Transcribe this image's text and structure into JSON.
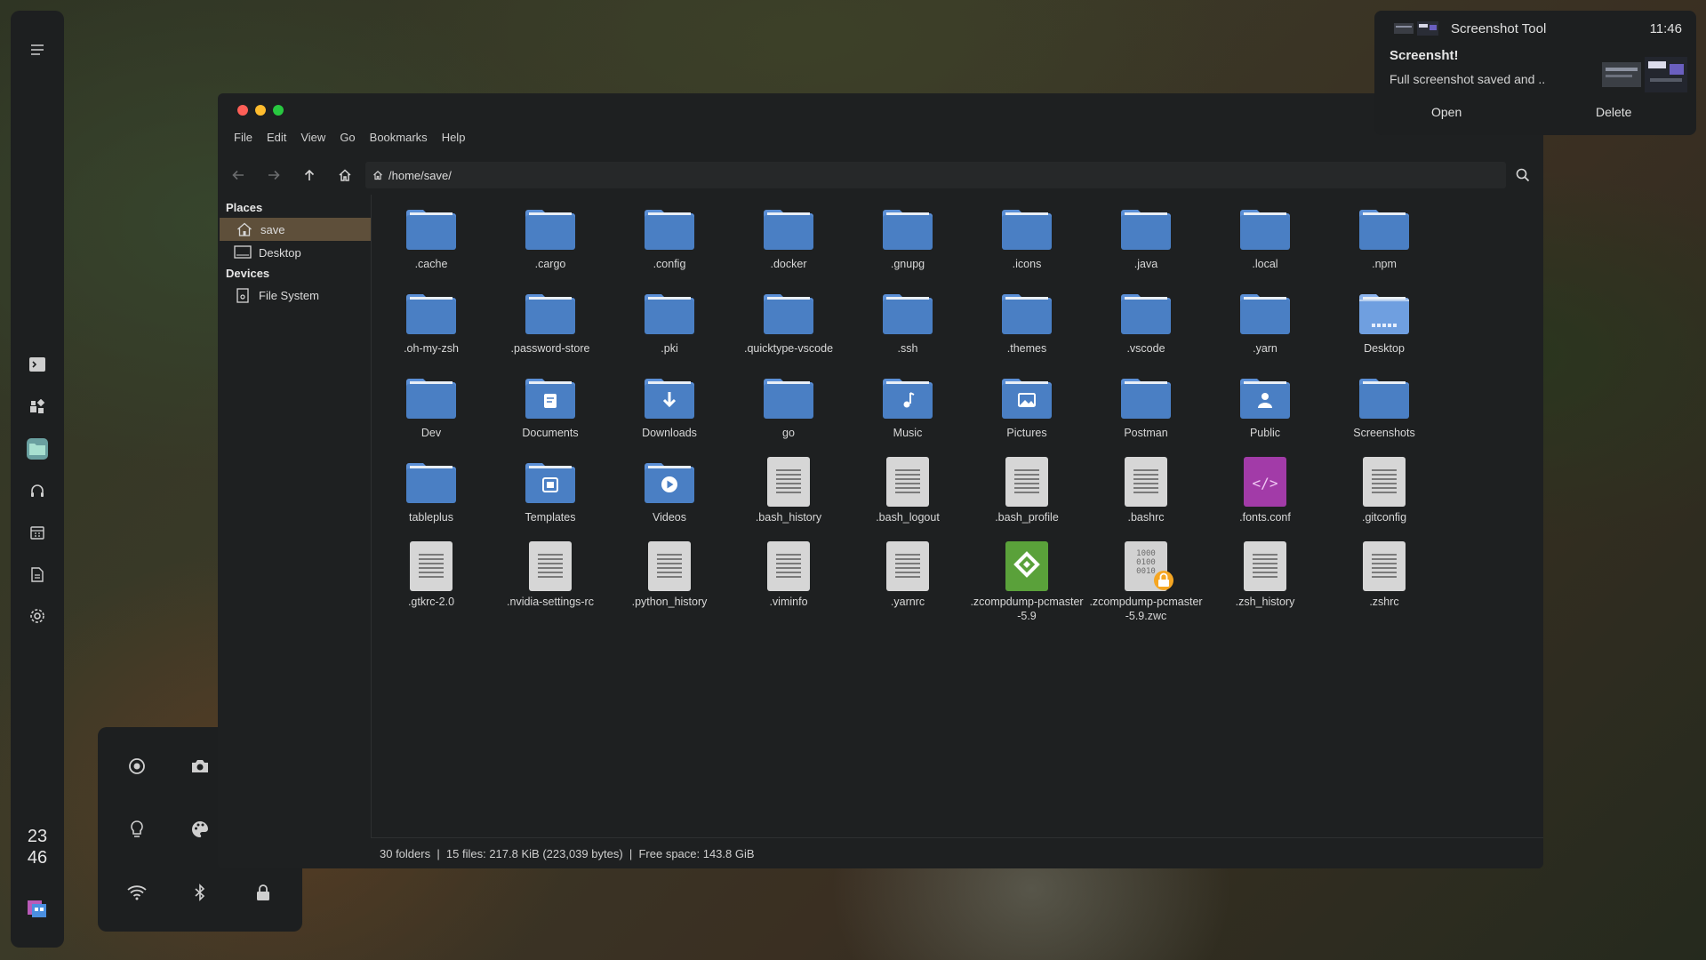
{
  "dock": {
    "clock_hour": "23",
    "clock_minute": "46",
    "items": [
      "terminal-icon",
      "apps-icon",
      "files-icon",
      "music-icon",
      "calendar-icon",
      "notes-icon",
      "settings-icon"
    ]
  },
  "window": {
    "menu": [
      "File",
      "Edit",
      "View",
      "Go",
      "Bookmarks",
      "Help"
    ],
    "path": "/home/save/",
    "sidebar": {
      "places_header": "Places",
      "places": [
        "save",
        "Desktop"
      ],
      "devices_header": "Devices",
      "devices": [
        "File System"
      ]
    },
    "files": [
      {
        "name": ".cache",
        "kind": "folder"
      },
      {
        "name": ".cargo",
        "kind": "folder"
      },
      {
        "name": ".config",
        "kind": "folder"
      },
      {
        "name": ".docker",
        "kind": "folder"
      },
      {
        "name": ".gnupg",
        "kind": "folder"
      },
      {
        "name": ".icons",
        "kind": "folder"
      },
      {
        "name": ".java",
        "kind": "folder"
      },
      {
        "name": ".local",
        "kind": "folder"
      },
      {
        "name": ".npm",
        "kind": "folder"
      },
      {
        "name": ".oh-my-zsh",
        "kind": "folder"
      },
      {
        "name": ".password-store",
        "kind": "folder"
      },
      {
        "name": ".pki",
        "kind": "folder"
      },
      {
        "name": ".quicktype-vscode",
        "kind": "folder"
      },
      {
        "name": ".ssh",
        "kind": "folder"
      },
      {
        "name": ".themes",
        "kind": "folder"
      },
      {
        "name": ".vscode",
        "kind": "folder"
      },
      {
        "name": ".yarn",
        "kind": "folder"
      },
      {
        "name": "Desktop",
        "kind": "folder-desktop"
      },
      {
        "name": "Dev",
        "kind": "folder"
      },
      {
        "name": "Documents",
        "kind": "folder-documents"
      },
      {
        "name": "Downloads",
        "kind": "folder-downloads"
      },
      {
        "name": "go",
        "kind": "folder"
      },
      {
        "name": "Music",
        "kind": "folder-music"
      },
      {
        "name": "Pictures",
        "kind": "folder-pictures"
      },
      {
        "name": "Postman",
        "kind": "folder"
      },
      {
        "name": "Public",
        "kind": "folder-public"
      },
      {
        "name": "Screenshots",
        "kind": "folder"
      },
      {
        "name": "tableplus",
        "kind": "folder"
      },
      {
        "name": "Templates",
        "kind": "folder-templates"
      },
      {
        "name": "Videos",
        "kind": "folder-videos"
      },
      {
        "name": ".bash_history",
        "kind": "text"
      },
      {
        "name": ".bash_logout",
        "kind": "text"
      },
      {
        "name": ".bash_profile",
        "kind": "text"
      },
      {
        "name": ".bashrc",
        "kind": "text"
      },
      {
        "name": ".fonts.conf",
        "kind": "xml"
      },
      {
        "name": ".gitconfig",
        "kind": "text"
      },
      {
        "name": ".gtkrc-2.0",
        "kind": "text"
      },
      {
        "name": ".nvidia-settings-rc",
        "kind": "text"
      },
      {
        "name": ".python_history",
        "kind": "text"
      },
      {
        "name": ".viminfo",
        "kind": "text"
      },
      {
        "name": ".yarnrc",
        "kind": "text"
      },
      {
        "name": ".zcompdump-pcmaster-5.9",
        "kind": "green"
      },
      {
        "name": ".zcompdump-pcmaster-5.9.zwc",
        "kind": "binary-locked"
      },
      {
        "name": ".zsh_history",
        "kind": "text"
      },
      {
        "name": ".zshrc",
        "kind": "text"
      }
    ],
    "binary_digits": "1000\n0100\n0010",
    "status": "30 folders  |  15 files: 217.8 KiB (223,039 bytes)  |  Free space: 143.8 GiB"
  },
  "notification": {
    "app": "Screenshot Tool",
    "time": "11:46",
    "title": "Screensht!",
    "body": "Full screenshot saved and ..",
    "open_label": "Open",
    "delete_label": "Delete"
  },
  "quick_panel": {
    "buttons": [
      "record-icon",
      "camera-icon",
      "color-picker-icon",
      "lightbulb-icon",
      "palette-icon",
      "microphone-icon",
      "wifi-icon",
      "bluetooth-icon",
      "lock-icon"
    ]
  },
  "colors": {
    "folder": "#4a7fc4",
    "folder_light": "#6f9fe0",
    "selection": "#5e4f3a",
    "close": "#ff5f57",
    "minimize": "#febc2e",
    "maximize": "#28c840"
  }
}
